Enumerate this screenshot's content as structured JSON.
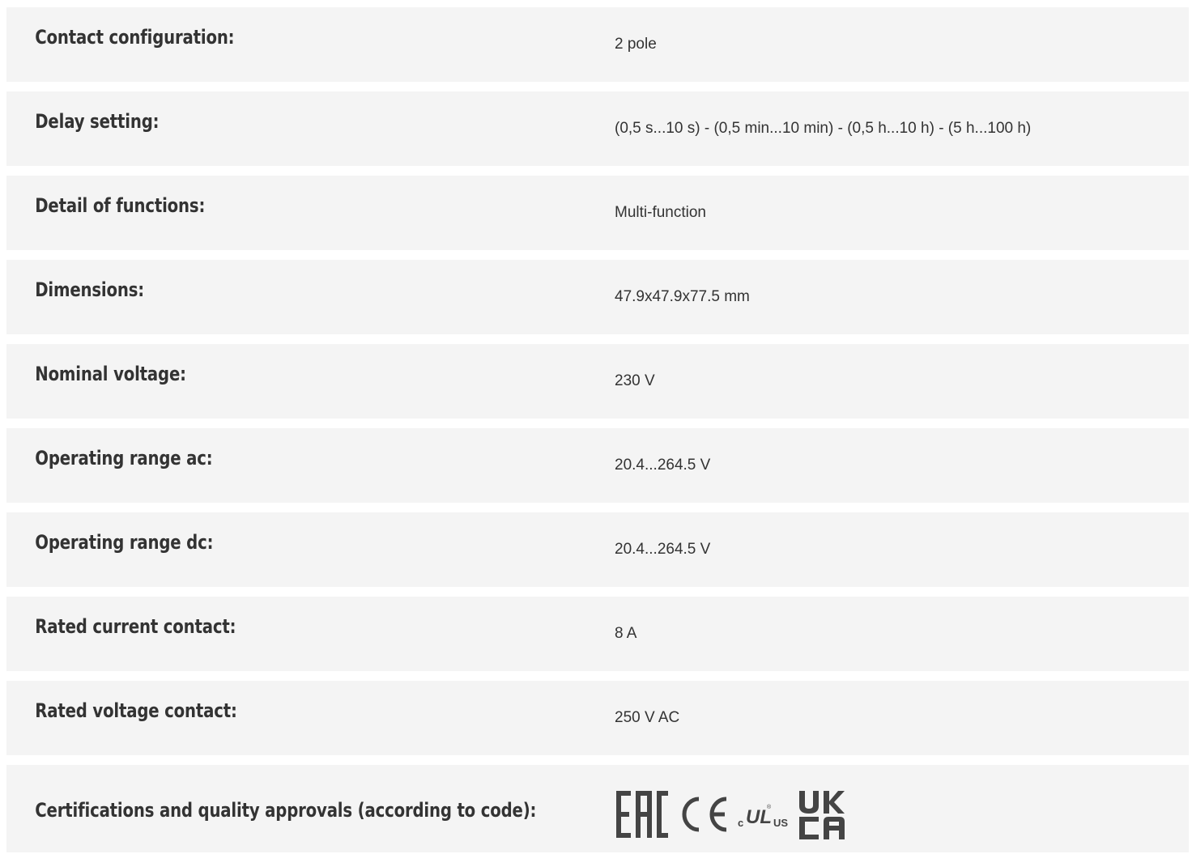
{
  "specs": [
    {
      "label": "Contact configuration:",
      "value": "2 pole"
    },
    {
      "label": "Delay setting:",
      "value": "(0,5 s...10 s) - (0,5 min...10 min) - (0,5 h...10 h) - (5 h...100 h)"
    },
    {
      "label": "Detail of functions:",
      "value": "Multi-function"
    },
    {
      "label": "Dimensions:",
      "value": "47.9x47.9x77.5 mm"
    },
    {
      "label": "Nominal voltage:",
      "value": "230 V"
    },
    {
      "label": "Operating range ac:",
      "value": "20.4...264.5 V"
    },
    {
      "label": "Operating range dc:",
      "value": "20.4...264.5 V"
    },
    {
      "label": "Rated current contact:",
      "value": "8 A"
    },
    {
      "label": "Rated voltage contact:",
      "value": "250 V AC"
    }
  ],
  "certifications": {
    "label": "Certifications and quality approvals (according to code):",
    "logos": [
      {
        "name": "eac-logo",
        "text": "EAC"
      },
      {
        "name": "ce-logo",
        "text": "CE"
      },
      {
        "name": "cul-us-logo",
        "text": "cULus"
      },
      {
        "name": "ukca-logo",
        "text": "UKCA"
      }
    ]
  },
  "colors": {
    "row_background": "#f4f4f4",
    "text": "#333333",
    "logo": "#444444"
  }
}
